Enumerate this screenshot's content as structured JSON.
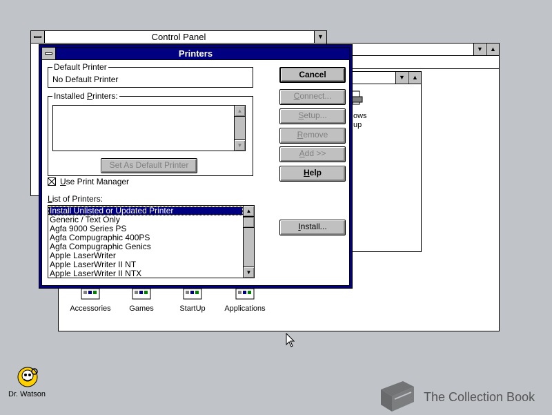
{
  "control_panel": {
    "title": "Control Panel"
  },
  "program_manager": {
    "group_icons": [
      {
        "label": "Accessories"
      },
      {
        "label": "Games"
      },
      {
        "label": "StartUp"
      },
      {
        "label": "Applications"
      }
    ],
    "partial_icon_label_1": "ows",
    "partial_icon_label_2": "up"
  },
  "printers": {
    "title": "Printers",
    "default_printer_label": "Default Printer",
    "default_printer_value": "No Default Printer",
    "installed_printers_label_pre": "Installed ",
    "installed_printers_label_u": "P",
    "installed_printers_label_post": "rinters:",
    "set_default_button": "Set As Default Printer",
    "use_print_manager_label_u": "U",
    "use_print_manager_label": "se Print Manager",
    "use_print_manager_checked": true,
    "list_label_pre": "",
    "list_label_u": "L",
    "list_label_post": "ist of Printers:",
    "list_items": [
      "Install Unlisted or Updated Printer",
      "Generic / Text Only",
      "Agfa 9000 Series PS",
      "Agfa Compugraphic 400PS",
      "Agfa Compugraphic Genics",
      "Apple LaserWriter",
      "Apple LaserWriter II NT",
      "Apple LaserWriter II NTX"
    ],
    "buttons": {
      "cancel": "Cancel",
      "connect_u": "C",
      "connect": "onnect...",
      "setup_u": "S",
      "setup": "etup...",
      "remove_u": "R",
      "remove": "emove",
      "add_u": "A",
      "add": "dd >>",
      "help_u": "H",
      "help": "elp",
      "install_u": "I",
      "install": "nstall..."
    }
  },
  "desktop": {
    "dr_watson_label": "Dr. Watson",
    "watermark_text": "The Collection Book"
  },
  "colors": {
    "desktop": "#c0c3c7",
    "active_title": "#000080",
    "button_face": "#c0c0c0"
  }
}
